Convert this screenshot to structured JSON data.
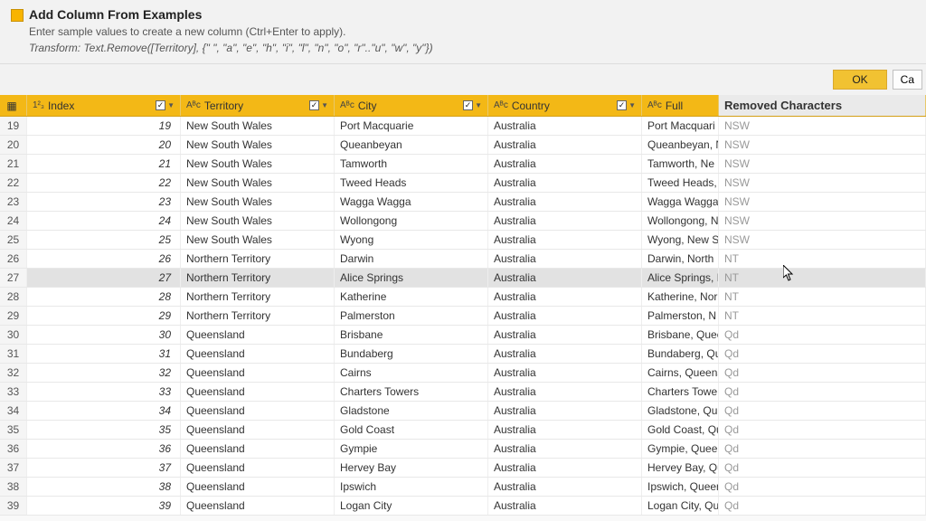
{
  "header": {
    "title": "Add Column From Examples",
    "subtitle": "Enter sample values to create a new column (Ctrl+Enter to apply).",
    "formula": "Transform: Text.Remove([Territory], {\" \", \"a\", \"e\", \"h\", \"i\", \"l\", \"n\", \"o\", \"r\"..\"u\", \"w\", \"y\"})"
  },
  "buttons": {
    "ok": "OK",
    "cancel": "Ca"
  },
  "columns": {
    "index": "Index",
    "territory": "Territory",
    "city": "City",
    "country": "Country",
    "full": "Full",
    "removed": "Removed Characters"
  },
  "type_icons": {
    "num": "1²₃",
    "text": "Aᴮc"
  },
  "rows": [
    {
      "n": "19",
      "idx": "19",
      "territory": "New South Wales",
      "city": "Port Macquarie",
      "country": "Australia",
      "full": "Port Macquari",
      "removed": "NSW"
    },
    {
      "n": "20",
      "idx": "20",
      "territory": "New South Wales",
      "city": "Queanbeyan",
      "country": "Australia",
      "full": "Queanbeyan, N",
      "removed": "NSW"
    },
    {
      "n": "21",
      "idx": "21",
      "territory": "New South Wales",
      "city": "Tamworth",
      "country": "Australia",
      "full": "Tamworth, Ne",
      "removed": "NSW"
    },
    {
      "n": "22",
      "idx": "22",
      "territory": "New South Wales",
      "city": "Tweed Heads",
      "country": "Australia",
      "full": "Tweed Heads,",
      "removed": "NSW"
    },
    {
      "n": "23",
      "idx": "23",
      "territory": "New South Wales",
      "city": "Wagga Wagga",
      "country": "Australia",
      "full": "Wagga Wagga,",
      "removed": "NSW"
    },
    {
      "n": "24",
      "idx": "24",
      "territory": "New South Wales",
      "city": "Wollongong",
      "country": "Australia",
      "full": "Wollongong, N",
      "removed": "NSW"
    },
    {
      "n": "25",
      "idx": "25",
      "territory": "New South Wales",
      "city": "Wyong",
      "country": "Australia",
      "full": "Wyong, New S",
      "removed": "NSW"
    },
    {
      "n": "26",
      "idx": "26",
      "territory": "Northern Territory",
      "city": "Darwin",
      "country": "Australia",
      "full": "Darwin, North",
      "removed": "NT"
    },
    {
      "n": "27",
      "idx": "27",
      "territory": "Northern Territory",
      "city": "Alice Springs",
      "country": "Australia",
      "full": "Alice Springs, N",
      "removed": "NT",
      "highlight": true
    },
    {
      "n": "28",
      "idx": "28",
      "territory": "Northern Territory",
      "city": "Katherine",
      "country": "Australia",
      "full": "Katherine, Nor",
      "removed": "NT"
    },
    {
      "n": "29",
      "idx": "29",
      "territory": "Northern Territory",
      "city": "Palmerston",
      "country": "Australia",
      "full": "Palmerston, N",
      "removed": "NT"
    },
    {
      "n": "30",
      "idx": "30",
      "territory": "Queensland",
      "city": "Brisbane",
      "country": "Australia",
      "full": "Brisbane, Quee",
      "removed": "Qd"
    },
    {
      "n": "31",
      "idx": "31",
      "territory": "Queensland",
      "city": "Bundaberg",
      "country": "Australia",
      "full": "Bundaberg, Qu",
      "removed": "Qd"
    },
    {
      "n": "32",
      "idx": "32",
      "territory": "Queensland",
      "city": "Cairns",
      "country": "Australia",
      "full": "Cairns, Queens",
      "removed": "Qd"
    },
    {
      "n": "33",
      "idx": "33",
      "territory": "Queensland",
      "city": "Charters Towers",
      "country": "Australia",
      "full": "Charters Towe",
      "removed": "Qd"
    },
    {
      "n": "34",
      "idx": "34",
      "territory": "Queensland",
      "city": "Gladstone",
      "country": "Australia",
      "full": "Gladstone, Qu",
      "removed": "Qd"
    },
    {
      "n": "35",
      "idx": "35",
      "territory": "Queensland",
      "city": "Gold Coast",
      "country": "Australia",
      "full": "Gold Coast, Qu",
      "removed": "Qd"
    },
    {
      "n": "36",
      "idx": "36",
      "territory": "Queensland",
      "city": "Gympie",
      "country": "Australia",
      "full": "Gympie, Quee",
      "removed": "Qd"
    },
    {
      "n": "37",
      "idx": "37",
      "territory": "Queensland",
      "city": "Hervey Bay",
      "country": "Australia",
      "full": "Hervey Bay, Qu",
      "removed": "Qd"
    },
    {
      "n": "38",
      "idx": "38",
      "territory": "Queensland",
      "city": "Ipswich",
      "country": "Australia",
      "full": "Ipswich, Queen",
      "removed": "Qd"
    },
    {
      "n": "39",
      "idx": "39",
      "territory": "Queensland",
      "city": "Logan City",
      "country": "Australia",
      "full": "Logan City, Qu",
      "removed": "Qd"
    }
  ]
}
